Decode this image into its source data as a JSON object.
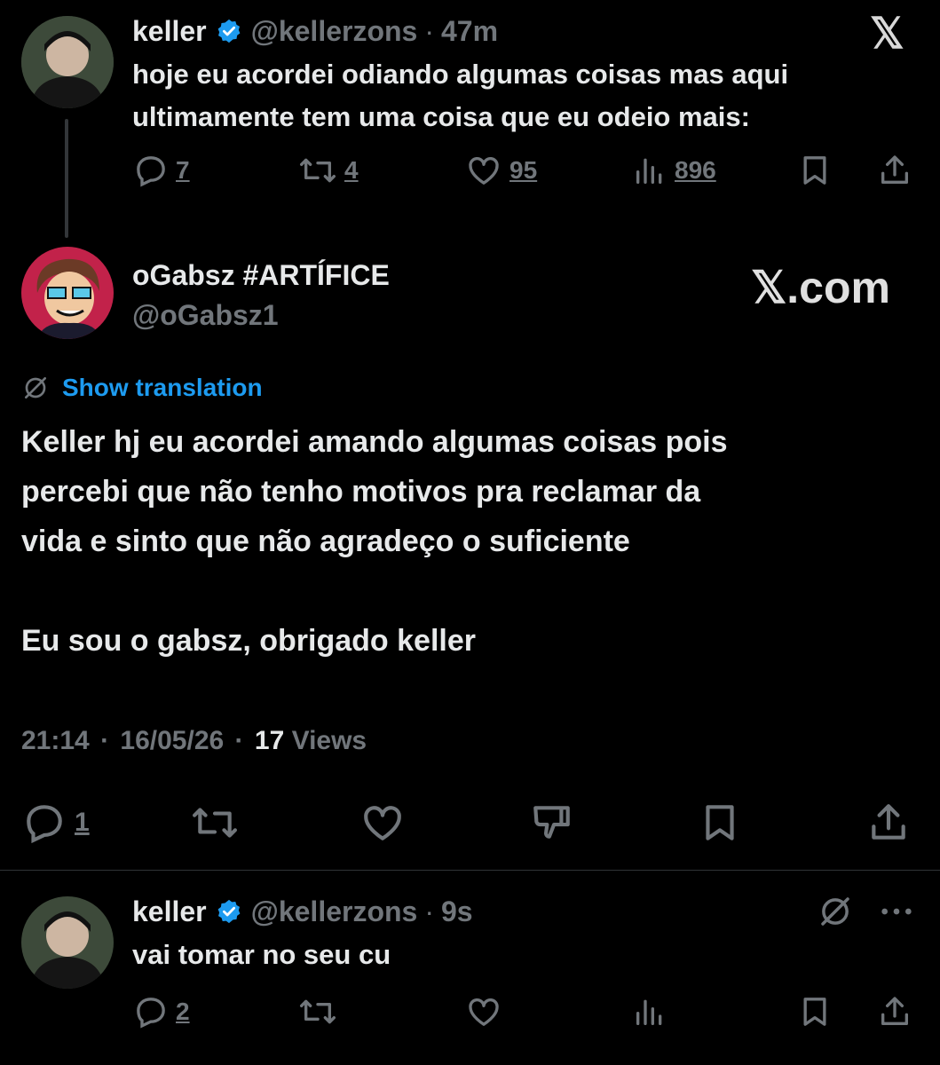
{
  "tweet1": {
    "name": "keller",
    "handle": "@kellerzons",
    "sep": "·",
    "time": "47m",
    "text_line1": "hoje eu acordei odiando algumas coisas mas aqui",
    "text_line2": "ultimamente tem uma coisa que eu odeio mais:",
    "replies": "7",
    "retweets": "4",
    "likes": "95",
    "views": "896"
  },
  "watermark": {
    "logo": "𝕏",
    "text": "𝕏.com"
  },
  "tweet2": {
    "name": "oGabsz #ARTÍFICE",
    "handle": "@oGabsz1",
    "translation_link": "Show translation",
    "line1": "Keller hj eu acordei amando algumas coisas pois",
    "line2": "percebi que não tenho motivos pra reclamar da",
    "line3": "vida e sinto que não agradeço o suficiente",
    "line4": "Eu sou o gabsz, obrigado keller",
    "time": "21:14",
    "date": "16/05/26",
    "views_count": "17",
    "views_label": "Views",
    "sep": "·",
    "replies": "1"
  },
  "tweet3": {
    "name": "keller",
    "handle": "@kellerzons",
    "sep": "·",
    "time": "9s",
    "text": "vai tomar no seu cu",
    "replies": "2"
  },
  "colors": {
    "background": "#000000",
    "text": "#e7e9ea",
    "muted": "#71767b",
    "accent": "#1d9bf0",
    "divider": "#2f3336"
  }
}
